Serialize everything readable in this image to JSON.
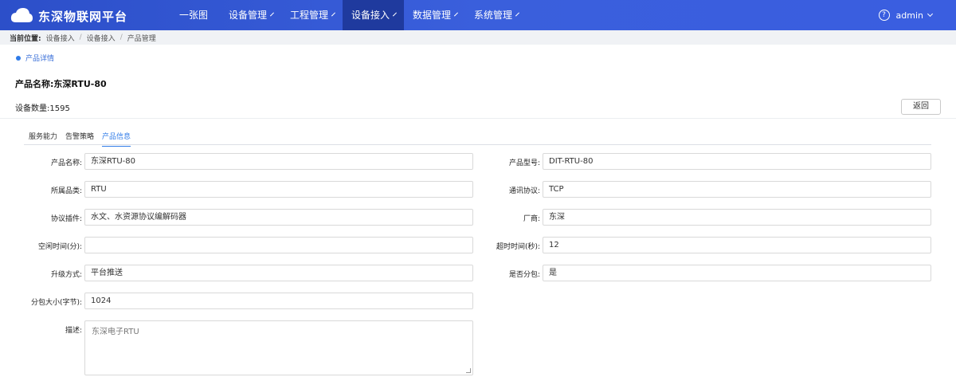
{
  "header": {
    "brand": "东深物联网平台",
    "nav": [
      {
        "label": "一张图",
        "has_dropdown": false,
        "active": false
      },
      {
        "label": "设备管理",
        "has_dropdown": true,
        "active": false
      },
      {
        "label": "工程管理",
        "has_dropdown": true,
        "active": false
      },
      {
        "label": "设备接入",
        "has_dropdown": true,
        "active": true
      },
      {
        "label": "数据管理",
        "has_dropdown": true,
        "active": false
      },
      {
        "label": "系统管理",
        "has_dropdown": true,
        "active": false
      }
    ],
    "user": "admin",
    "help_icon": "?"
  },
  "breadcrumb": {
    "lead": "当前位置:",
    "items": [
      "设备接入",
      "设备接入",
      "产品管理"
    ]
  },
  "section": {
    "title": "产品详情"
  },
  "product": {
    "title": "产品名称:东深RTU-80",
    "device_count": "设备数量:1595",
    "back_label": "返回"
  },
  "tabs": [
    {
      "label": "服务能力",
      "active": false
    },
    {
      "label": "告警策略",
      "active": false
    },
    {
      "label": "产品信息",
      "active": true
    }
  ],
  "form": {
    "product_name": {
      "label": "产品名称:",
      "value": "东深RTU-80"
    },
    "product_model": {
      "label": "产品型号:",
      "value": "DIT-RTU-80"
    },
    "category": {
      "label": "所属品类:",
      "value": "RTU"
    },
    "protocol": {
      "label": "通讯协议:",
      "value": "TCP"
    },
    "plugin": {
      "label": "协议插件:",
      "value": "水文、水资源协议编解码器"
    },
    "vendor": {
      "label": "厂商:",
      "value": "东深"
    },
    "idle_time": {
      "label": "空闲时间(分):",
      "value": ""
    },
    "timeout": {
      "label": "超时时间(秒):",
      "value": "12"
    },
    "upgrade": {
      "label": "升级方式:",
      "value": "平台推送"
    },
    "subpackage": {
      "label": "是否分包:",
      "value": "是"
    },
    "package_size": {
      "label": "分包大小(字节):",
      "value": "1024"
    },
    "description": {
      "label": "描述:",
      "value": "东深电子RTU"
    }
  },
  "colors": {
    "accent": "#2f7be8",
    "nav_bg": "#3a5fdc",
    "nav_active": "#1f3a9e"
  }
}
